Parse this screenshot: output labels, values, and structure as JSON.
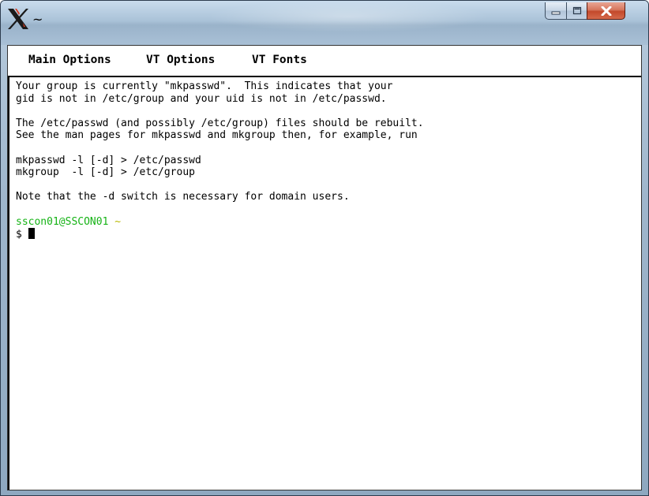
{
  "window": {
    "title": "~",
    "controls": {
      "minimize_icon": "minimize-icon",
      "maximize_icon": "maximize-icon",
      "close_icon": "close-icon"
    }
  },
  "menubar": {
    "items": [
      {
        "label": "Main Options"
      },
      {
        "label": "VT Options"
      },
      {
        "label": "VT Fonts"
      }
    ]
  },
  "terminal": {
    "lines": [
      "Your group is currently \"mkpasswd\".  This indicates that your",
      "gid is not in /etc/group and your uid is not in /etc/passwd.",
      "",
      "The /etc/passwd (and possibly /etc/group) files should be rebuilt.",
      "See the man pages for mkpasswd and mkgroup then, for example, run",
      "",
      "mkpasswd -l [-d] > /etc/passwd",
      "mkgroup  -l [-d] > /etc/group",
      "",
      "Note that the -d switch is necessary for domain users.",
      ""
    ],
    "prompt_user": "sscon01@SSCON01",
    "prompt_path": "~",
    "prompt_symbol": "$ ",
    "colors": {
      "prompt_user": "#16b316",
      "prompt_path": "#b8b800",
      "text": "#000000",
      "background": "#ffffff"
    }
  }
}
